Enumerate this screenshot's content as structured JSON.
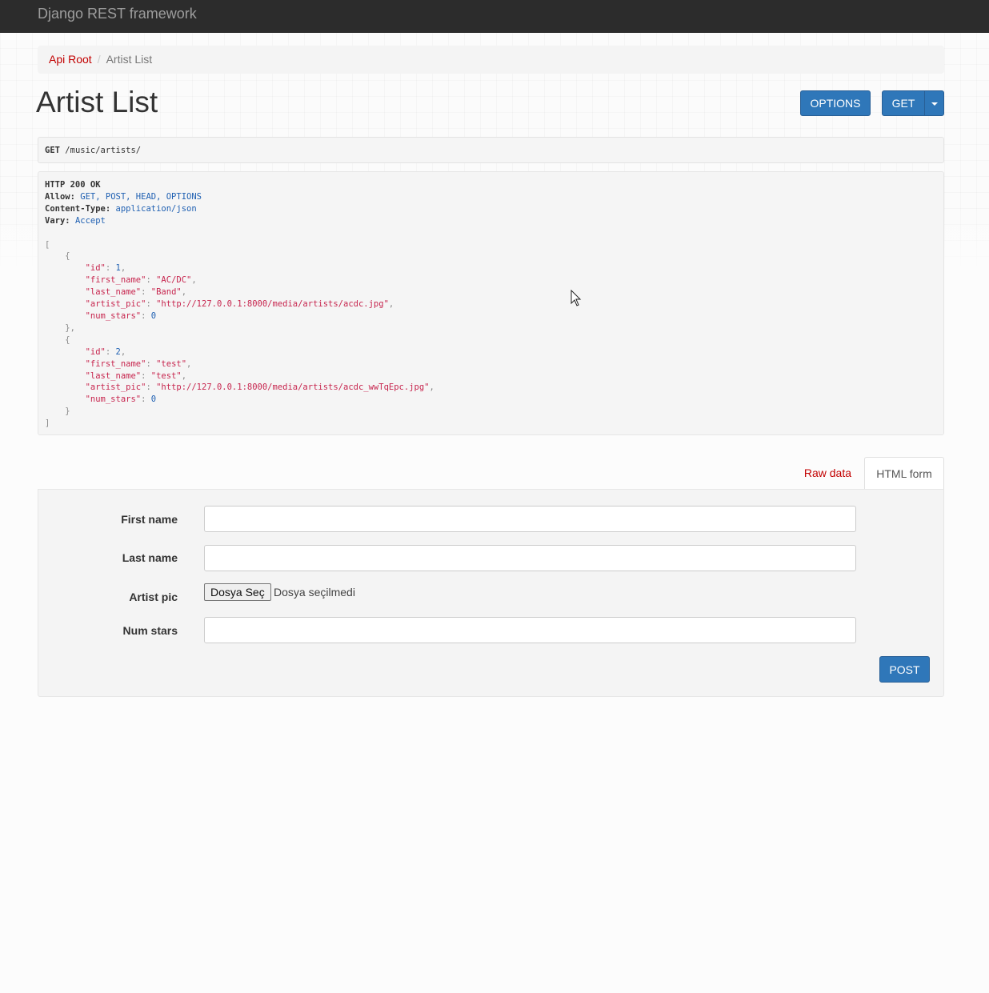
{
  "navbar": {
    "brand": "Django REST framework"
  },
  "breadcrumb": {
    "root": "Api Root",
    "separator": "/",
    "current": "Artist List"
  },
  "page_title": "Artist List",
  "buttons": {
    "options": "OPTIONS",
    "get": "GET",
    "post": "POST"
  },
  "request": {
    "method": "GET",
    "path": "/music/artists/"
  },
  "response": {
    "status": "HTTP 200 OK",
    "headers": [
      {
        "name": "Allow",
        "value": "GET, POST, HEAD, OPTIONS"
      },
      {
        "name": "Content-Type",
        "value": "application/json"
      },
      {
        "name": "Vary",
        "value": "Accept"
      }
    ],
    "items": [
      {
        "id": 1,
        "first_name": "AC/DC",
        "last_name": "Band",
        "artist_pic": "http://127.0.0.1:8000/media/artists/acdc.jpg",
        "num_stars": 0
      },
      {
        "id": 2,
        "first_name": "test",
        "last_name": "test",
        "artist_pic": "http://127.0.0.1:8000/media/artists/acdc_wwTqEpc.jpg",
        "num_stars": 0
      }
    ]
  },
  "tabs": {
    "raw": "Raw data",
    "html": "HTML form"
  },
  "form": {
    "first_name_label": "First name",
    "last_name_label": "Last name",
    "artist_pic_label": "Artist pic",
    "num_stars_label": "Num stars",
    "first_name_value": "",
    "last_name_value": "",
    "num_stars_value": "",
    "file_button": "Dosya Seç",
    "file_status": "Dosya seçilmedi"
  },
  "colors": {
    "navbar": "#2c2c2c",
    "link": "#c20000",
    "primary": "#2f77b9"
  },
  "icons": {
    "dropdown": "caret-down-icon",
    "pointer": "mouse-cursor-icon"
  }
}
